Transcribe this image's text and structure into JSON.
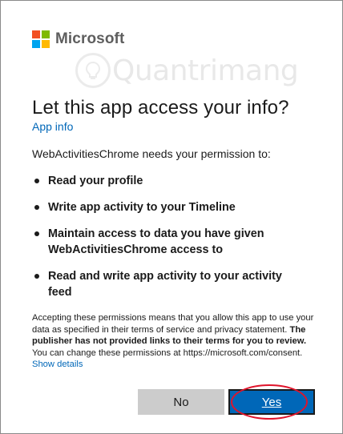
{
  "brand": {
    "name": "Microsoft",
    "colors": [
      "#f25022",
      "#7fba00",
      "#00a4ef",
      "#ffb900"
    ]
  },
  "watermark": {
    "text": "Quantrimang"
  },
  "title": "Let this app access your info?",
  "app_info_link": "App info",
  "intro": "WebActivitiesChrome needs your permission to:",
  "permissions": [
    "Read your profile",
    "Write app activity to your Timeline",
    "Maintain access to data you have given WebActivitiesChrome access to",
    "Read and write app activity to your activity feed"
  ],
  "fine_print": {
    "part1": "Accepting these permissions means that you allow this app to use your data as specified in their terms of service and privacy statement. ",
    "bold": "The publisher has not provided links to their terms for you to review.",
    "part2": " You can change these permissions at https://microsoft.com/consent. ",
    "link": "Show details"
  },
  "buttons": {
    "no": "No",
    "yes": "Yes"
  },
  "colors": {
    "accent": "#0067b8",
    "button_secondary": "#cccccc",
    "annotation": "#e0142b"
  }
}
